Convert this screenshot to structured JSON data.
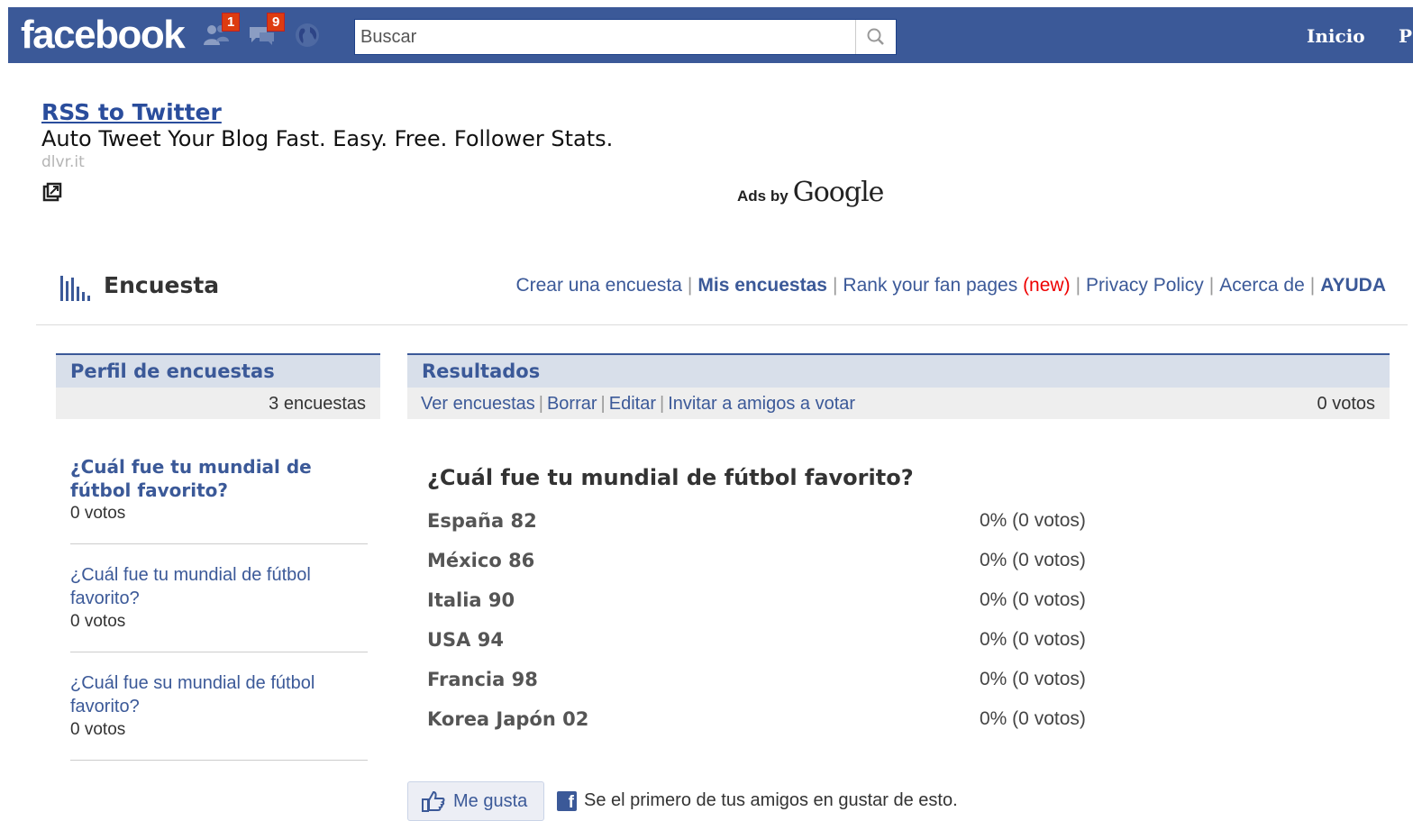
{
  "topbar": {
    "logo": "facebook",
    "friend_requests_count": "1",
    "messages_count": "9",
    "search_placeholder": "Buscar",
    "nav_home": "Inicio",
    "nav_profile": "P",
    "bg_color": "#3b5998"
  },
  "ad": {
    "title": "RSS to Twitter",
    "text": "Auto Tweet Your Blog Fast. Easy. Free. Follower Stats.",
    "url": "dlvr.it",
    "ads_by": "Ads by",
    "google": "Google"
  },
  "app": {
    "title": "Encuesta",
    "nav": {
      "create": "Crear una encuesta",
      "my_polls": "Mis encuestas",
      "rank": "Rank your fan pages",
      "new": "(new)",
      "privacy": "Privacy Policy",
      "about": "Acerca de",
      "help": "AYUDA",
      "separator": "|"
    }
  },
  "left_panel": {
    "title": "Perfil de encuestas",
    "count": "3 encuestas",
    "polls": [
      {
        "question": "¿Cuál fue tu mundial de fútbol favorito?",
        "votes": "0 votos"
      },
      {
        "question": "¿Cuál fue tu mundial de fútbol favorito?",
        "votes": "0 votos"
      },
      {
        "question": "¿Cuál fue su mundial de fútbol favorito?",
        "votes": "0 votos"
      }
    ]
  },
  "results": {
    "title": "Resultados",
    "actions": {
      "view": "Ver encuestas",
      "delete": "Borrar",
      "edit": "Editar",
      "invite": "Invitar a amigos a votar",
      "separator": "|"
    },
    "total_votes": "0 votos",
    "question": "¿Cuál fue tu mundial de fútbol favorito?",
    "options": [
      {
        "label": "España 82",
        "result": "0% (0 votos)"
      },
      {
        "label": "México 86",
        "result": "0% (0 votos)"
      },
      {
        "label": "Italia 90",
        "result": "0% (0 votos)"
      },
      {
        "label": "USA 94",
        "result": "0% (0 votos)"
      },
      {
        "label": "Francia 98",
        "result": "0% (0 votos)"
      },
      {
        "label": "Korea Japón 02",
        "result": "0% (0 votos)"
      }
    ]
  },
  "like": {
    "button": "Me gusta",
    "text": "Se el primero de tus amigos en gustar de esto.",
    "fb_letter": "f"
  }
}
